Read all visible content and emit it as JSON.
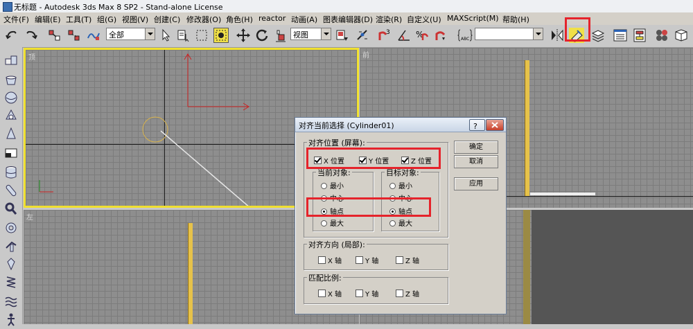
{
  "app": {
    "title": "无标题 - Autodesk 3ds Max 8 SP2 - Stand-alone License"
  },
  "menu": [
    "文件(F)",
    "编辑(E)",
    "工具(T)",
    "组(G)",
    "视图(V)",
    "创建(C)",
    "修改器(O)",
    "角色(H)",
    "reactor",
    "动画(A)",
    "图表编辑器(D)",
    "渲染(R)",
    "自定义(U)",
    "MAXScript(M)",
    "帮助(H)"
  ],
  "toolbar": {
    "selection_filter": "全部",
    "reference_coord": "视图",
    "named_selection": ""
  },
  "viewports": {
    "top": "顶",
    "front": "前",
    "left": "左"
  },
  "dialog": {
    "title": "对齐当前选择 (Cylinder01)",
    "help_button": "?",
    "position_group": "对齐位置 (屏幕):",
    "x_position": "X 位置",
    "y_position": "Y 位置",
    "z_position": "Z 位置",
    "current_group": "当前对象:",
    "target_group": "目标对象:",
    "current_options": [
      "最小",
      "中心",
      "轴点",
      "最大"
    ],
    "target_options": [
      "最小",
      "中心",
      "轴点",
      "最大"
    ],
    "current_selected": "轴点",
    "target_selected": "轴点",
    "orientation_group": "对齐方向 (局部):",
    "orientation_axes": [
      "X 轴",
      "Y 轴",
      "Z 轴"
    ],
    "scale_group": "匹配比例:",
    "scale_axes": [
      "X 轴",
      "Y 轴",
      "Z 轴"
    ],
    "ok": "确定",
    "cancel": "取消",
    "apply": "应用"
  },
  "colors": {
    "highlight": "#e5232b",
    "active_viewport_border": "#f0e030",
    "object_yellow": "#e6c24a"
  }
}
